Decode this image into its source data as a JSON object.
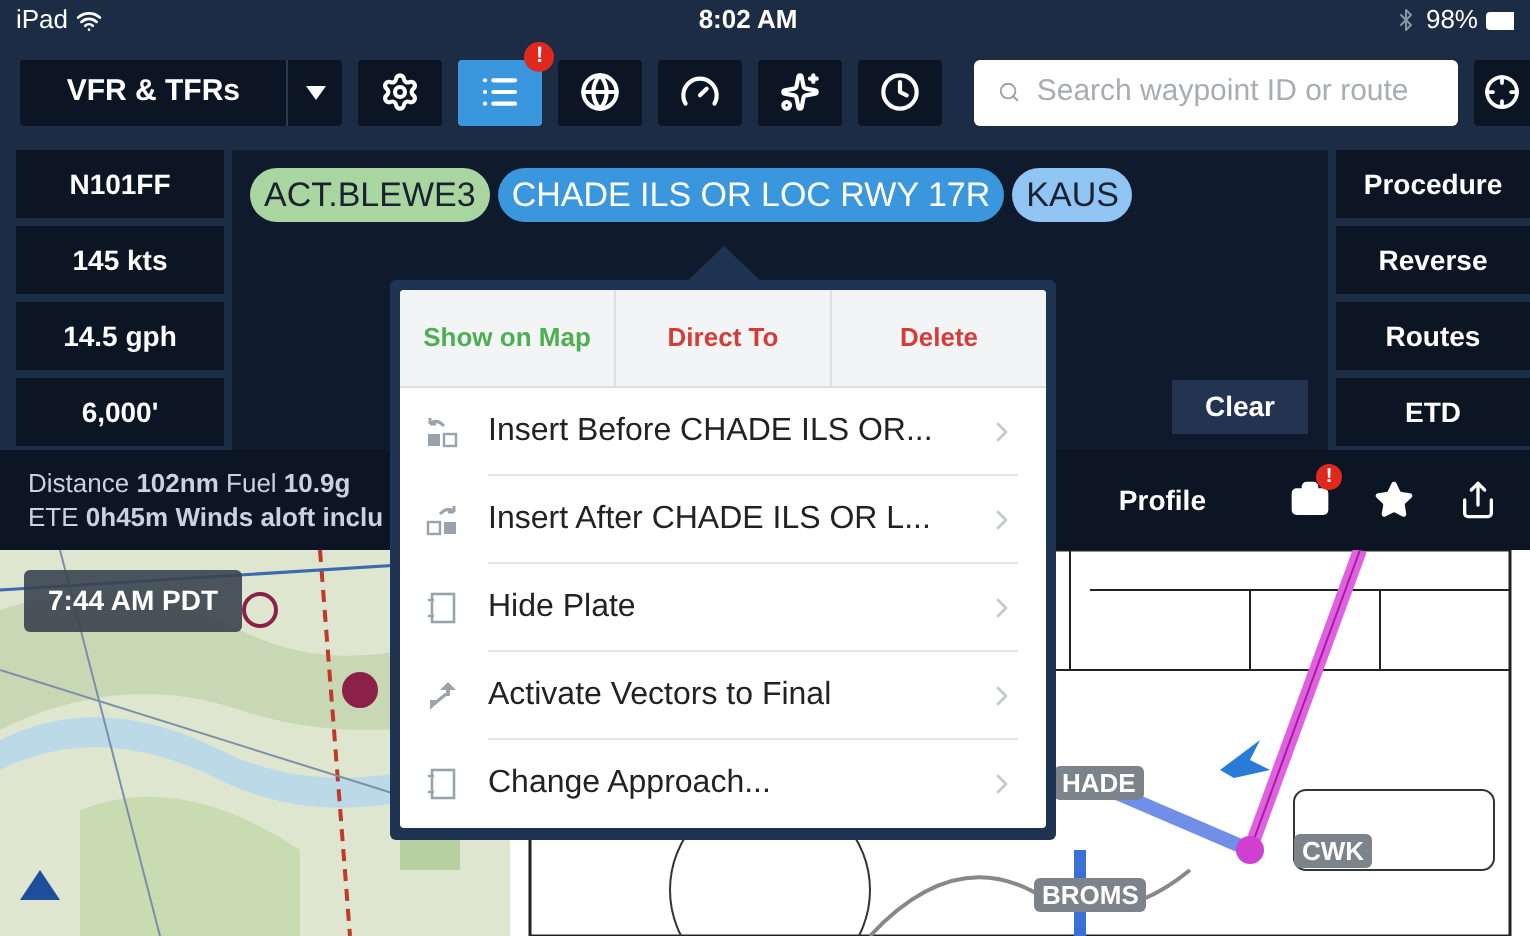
{
  "status_bar": {
    "device": "iPad",
    "time": "8:02 AM",
    "battery": "98%"
  },
  "toolbar": {
    "layer_selector": "VFR & TFRs",
    "buttons": [
      {
        "kind": "gear",
        "selected": false
      },
      {
        "kind": "list",
        "selected": true,
        "badge": "!"
      },
      {
        "kind": "globe",
        "selected": false
      },
      {
        "kind": "gauge",
        "selected": false
      },
      {
        "kind": "stars",
        "selected": false
      },
      {
        "kind": "clock",
        "selected": false
      }
    ],
    "search": {
      "placeholder": "Search waypoint ID or route"
    }
  },
  "aircraft_fields": [
    "N101FF",
    "145 kts",
    "14.5 gph",
    "6,000'"
  ],
  "route": [
    {
      "label": "ACT.BLEWE3",
      "color": "#a9d6a0",
      "selected": false
    },
    {
      "label": "CHADE ILS OR LOC RWY 17R",
      "color": "#3a97dd",
      "selected": true
    },
    {
      "label": "KAUS",
      "color": "#8fc4f3",
      "selected": false
    }
  ],
  "clear_button": "Clear",
  "side_buttons": [
    "Procedure",
    "Reverse",
    "Routes",
    "ETD"
  ],
  "summary": [
    "Distance **102nm**  Fuel **10.9g**",
    "ETE **0h45m  Winds aloft inclu**"
  ],
  "info_actions": {
    "profile": "Profile",
    "badge": "!"
  },
  "popover": {
    "actions": [
      {
        "label": "Show on Map",
        "color": "#4caf50"
      },
      {
        "label": "Direct To",
        "color": "#d63c35"
      },
      {
        "label": "Delete",
        "color": "#d63c35"
      }
    ],
    "items": [
      {
        "label": "Insert Before CHADE ILS OR...",
        "kind": "insert_before"
      },
      {
        "label": "Insert After CHADE ILS OR L...",
        "kind": "insert_after"
      },
      {
        "label": "Hide Plate",
        "kind": "plate"
      },
      {
        "label": "Activate Vectors to Final",
        "kind": "vectors"
      },
      {
        "label": "Change Approach...",
        "kind": "plate"
      }
    ]
  },
  "map": {
    "time_badge": "7:44 AM PDT"
  },
  "plate": {
    "waypoints": [
      "HADE",
      "CWK",
      "BROMS"
    ]
  }
}
